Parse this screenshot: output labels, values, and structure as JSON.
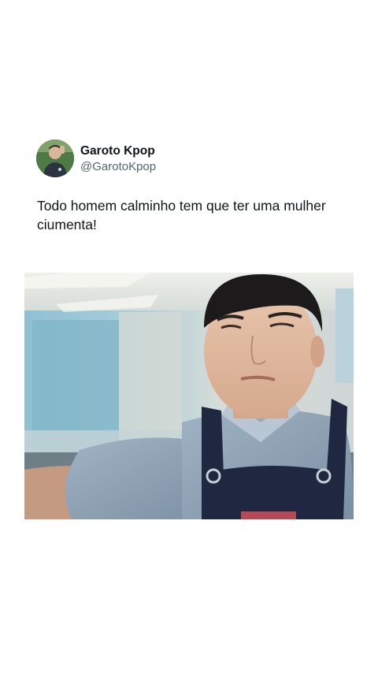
{
  "tweet": {
    "display_name": "Garoto Kpop",
    "handle": "@GarotoKpop",
    "text": "Todo homem calminho tem que ter uma mulher ciumenta!",
    "media": {
      "kind": "video-frame"
    }
  }
}
